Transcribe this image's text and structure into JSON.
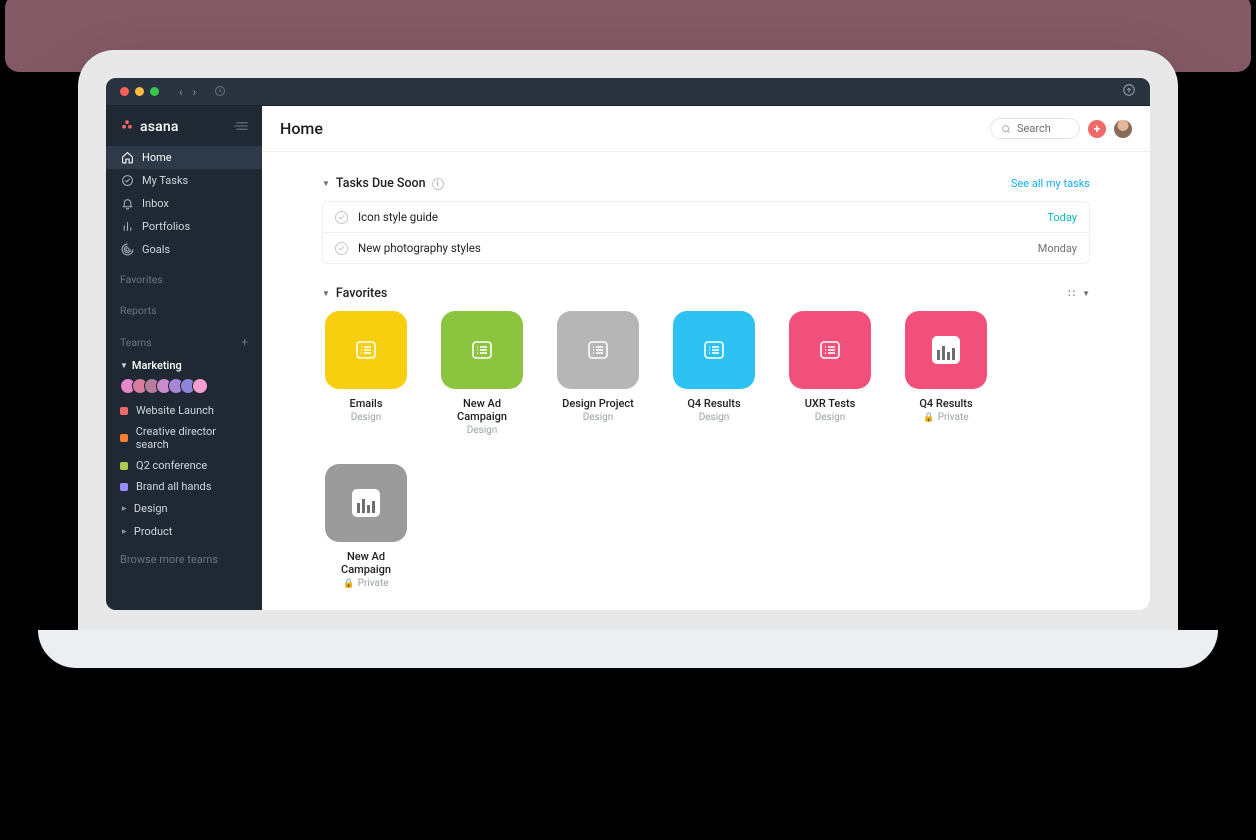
{
  "brand": {
    "name": "asana"
  },
  "sidebar": {
    "nav": [
      {
        "icon": "home",
        "label": "Home",
        "active": true
      },
      {
        "icon": "check",
        "label": "My Tasks",
        "active": false
      },
      {
        "icon": "bell",
        "label": "Inbox",
        "active": false
      },
      {
        "icon": "bars",
        "label": "Portfolios",
        "active": false
      },
      {
        "icon": "target",
        "label": "Goals",
        "active": false
      }
    ],
    "sections": {
      "favorites": "Favorites",
      "reports": "Reports",
      "teams": "Teams",
      "browse": "Browse more teams"
    },
    "team": {
      "name": "Marketing",
      "projects": [
        {
          "label": "Website Launch",
          "color": "#f06a6a"
        },
        {
          "label": "Creative director search",
          "color": "#f6802e"
        },
        {
          "label": "Q2 conference",
          "color": "#aecb4e"
        },
        {
          "label": "Brand all hands",
          "color": "#9a8cff"
        }
      ],
      "subteams": [
        "Design",
        "Product"
      ]
    }
  },
  "header": {
    "title": "Home",
    "search_placeholder": "Search"
  },
  "tasks": {
    "heading": "Tasks Due Soon",
    "see_all": "See all my tasks",
    "items": [
      {
        "title": "Icon style guide",
        "due": "Today",
        "today": true
      },
      {
        "title": "New photography styles",
        "due": "Monday",
        "today": false
      }
    ]
  },
  "favorites": {
    "heading": "Favorites",
    "cards": [
      {
        "title": "Emails",
        "subtitle": "Design",
        "color": "#f8cf0f",
        "type": "list"
      },
      {
        "title": "New Ad Campaign",
        "subtitle": "Design",
        "color": "#8bc53f",
        "type": "list"
      },
      {
        "title": "Design Project",
        "subtitle": "Design",
        "color": "#b6b6b6",
        "type": "list"
      },
      {
        "title": "Q4 Results",
        "subtitle": "Design",
        "color": "#2ec2f2",
        "type": "list"
      },
      {
        "title": "UXR Tests",
        "subtitle": "Design",
        "color": "#f1507b",
        "type": "list"
      },
      {
        "title": "Q4 Results",
        "subtitle": "Private",
        "color": "#f1507b",
        "type": "chart",
        "private": true
      },
      {
        "title": "New Ad Campaign",
        "subtitle": "Private",
        "color": "#9b9b9b",
        "type": "chart",
        "private": true
      }
    ]
  }
}
